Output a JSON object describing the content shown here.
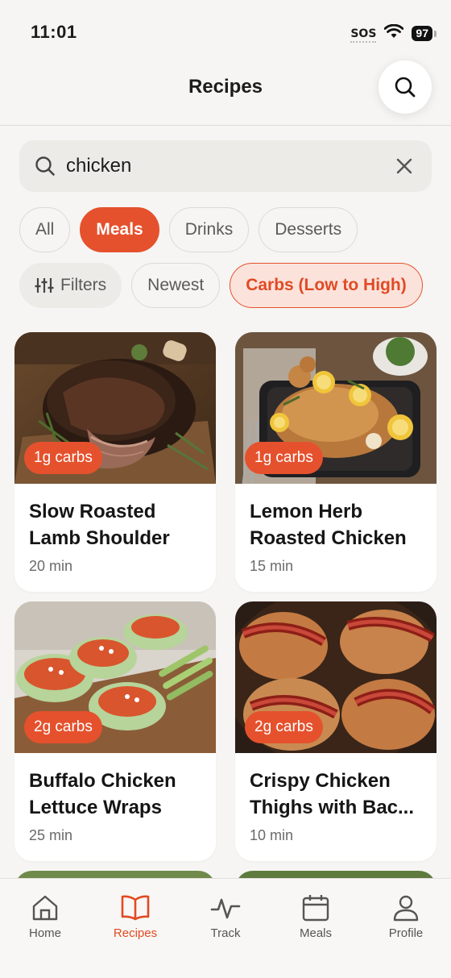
{
  "status_bar": {
    "time": "11:01",
    "sos": "SOS",
    "battery": "97"
  },
  "header": {
    "title": "Recipes"
  },
  "search": {
    "value": "chicken"
  },
  "category_chips": [
    {
      "label": "All",
      "active": false
    },
    {
      "label": "Meals",
      "active": true
    },
    {
      "label": "Drinks",
      "active": false
    },
    {
      "label": "Desserts",
      "active": false
    }
  ],
  "sort_chips": {
    "filters_label": "Filters",
    "newest_label": "Newest",
    "carbs_label": "Carbs (Low to High)"
  },
  "recipes": [
    {
      "title": "Slow Roasted Lamb Shoulder",
      "time": "20 min",
      "carbs": "1g carbs"
    },
    {
      "title": "Lemon Herb Roasted Chicken",
      "time": "15 min",
      "carbs": "1g carbs"
    },
    {
      "title": "Buffalo Chicken Lettuce Wraps",
      "time": "25 min",
      "carbs": "2g carbs"
    },
    {
      "title": "Crispy Chicken Thighs with Bac...",
      "time": "10 min",
      "carbs": "2g carbs"
    }
  ],
  "tab_bar": [
    {
      "label": "Home",
      "icon": "home-icon",
      "active": false
    },
    {
      "label": "Recipes",
      "icon": "book-icon",
      "active": true
    },
    {
      "label": "Track",
      "icon": "activity-icon",
      "active": false
    },
    {
      "label": "Meals",
      "icon": "calendar-icon",
      "active": false
    },
    {
      "label": "Profile",
      "icon": "person-icon",
      "active": false
    }
  ],
  "colors": {
    "accent": "#e5512d",
    "accent_soft": "#fbe3dc",
    "background": "#f6f5f3"
  }
}
